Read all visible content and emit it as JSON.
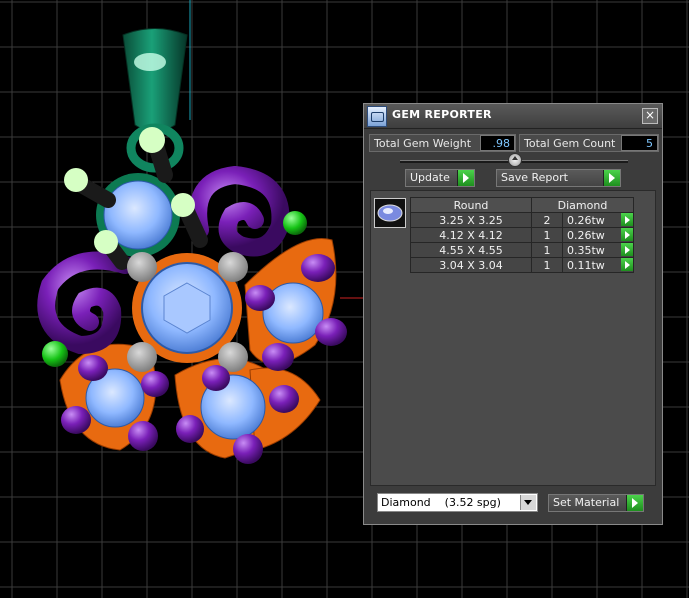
{
  "panel": {
    "title": "GEM REPORTER",
    "close_icon": "×",
    "total_gem_weight_label": "Total Gem Weight",
    "total_gem_weight_value": ".98",
    "total_gem_count_label": "Total Gem Count",
    "total_gem_count_value": "5",
    "update_label": "Update",
    "save_report_label": "Save Report",
    "table": {
      "columns": [
        "Round",
        "Diamond"
      ],
      "rows": [
        {
          "size": "3.25 X 3.25",
          "count": "2",
          "weight": "0.26tw"
        },
        {
          "size": "4.12 X 4.12",
          "count": "1",
          "weight": "0.26tw"
        },
        {
          "size": "4.55 X 4.55",
          "count": "1",
          "weight": "0.35tw"
        },
        {
          "size": "3.04 X 3.04",
          "count": "1",
          "weight": "0.11tw"
        }
      ]
    },
    "material_selected": "Diamond    (3.52 spg)",
    "set_material_label": "Set Material"
  },
  "colors": {
    "panel_bg": "#3c3c3c",
    "value_text": "#7fc7ff",
    "go_button": "#2fb02f",
    "gem_blue": "#8fb8ff",
    "metal_orange": "#e86a10",
    "metal_purple": "#6a1aa0",
    "bail_green": "#0f6a4a",
    "prong_gray": "#9a9a9a",
    "grid_line": "#3a3a3a"
  },
  "icons": {
    "app": "gem-reporter-app-icon",
    "close": "close-icon",
    "go": "play-arrow-icon",
    "dropdown": "chevron-down-icon",
    "slider": "slider-knob-icon"
  }
}
